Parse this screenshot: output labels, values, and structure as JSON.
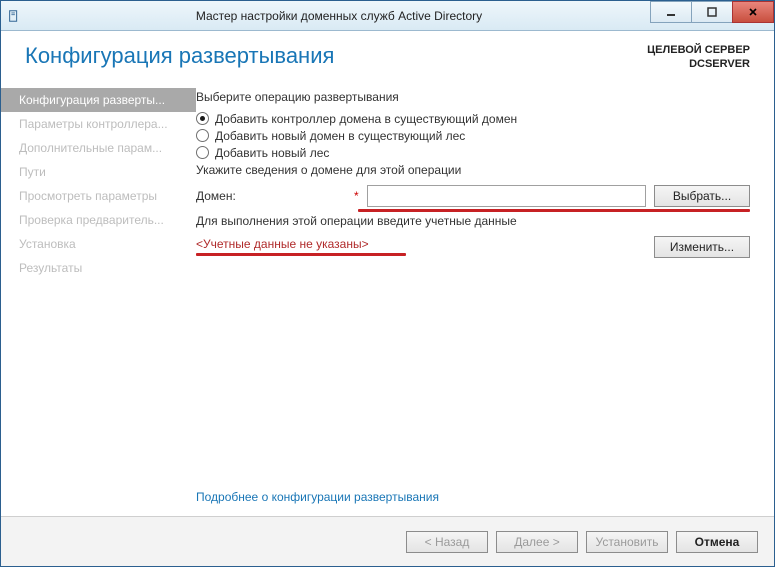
{
  "titlebar": {
    "title": "Мастер настройки доменных служб Active Directory"
  },
  "header": {
    "page_title": "Конфигурация развертывания",
    "target_label": "ЦЕЛЕВОЙ СЕРВЕР",
    "target_name": "DCSERVER"
  },
  "sidebar": {
    "items": [
      {
        "label": "Конфигурация разверты..."
      },
      {
        "label": "Параметры контроллера..."
      },
      {
        "label": "Дополнительные парам..."
      },
      {
        "label": "Пути"
      },
      {
        "label": "Просмотреть параметры"
      },
      {
        "label": "Проверка предваритель..."
      },
      {
        "label": "Установка"
      },
      {
        "label": "Результаты"
      }
    ]
  },
  "pane": {
    "select_op_label": "Выберите операцию развертывания",
    "radios": [
      "Добавить контроллер домена в существующий домен",
      "Добавить новый домен в существующий лес",
      "Добавить новый лес"
    ],
    "domain_info_label": "Укажите сведения о домене для этой операции",
    "domain_label": "Домен:",
    "domain_value": "",
    "select_btn": "Выбрать...",
    "creds_label": "Для выполнения этой операции введите учетные данные",
    "creds_value": "<Учетные данные не указаны>",
    "change_btn": "Изменить...",
    "more_link": "Подробнее о конфигурации развертывания"
  },
  "footer": {
    "back": "< Назад",
    "next": "Далее >",
    "install": "Установить",
    "cancel": "Отмена"
  }
}
